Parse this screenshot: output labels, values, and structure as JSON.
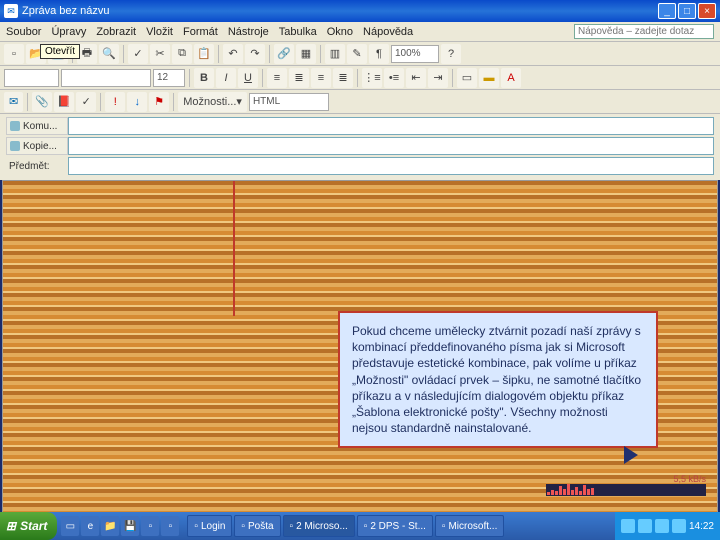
{
  "window": {
    "title": "Zpráva bez názvu",
    "icon_glyph": "✉"
  },
  "menu": [
    "Soubor",
    "Úpravy",
    "Zobrazit",
    "Vložit",
    "Formát",
    "Nástroje",
    "Tabulka",
    "Okno",
    "Nápověda"
  ],
  "help_placeholder": "Nápověda – zadejte dotaz",
  "tooltip": "Otevřít",
  "toolbar1": {
    "zoom": "100%"
  },
  "toolbar2": {
    "font_size": "12",
    "style_placeholder": ""
  },
  "toolbar3": {
    "label_moznosti": "Možnosti...",
    "format": "HTML"
  },
  "fields": {
    "to": "Komu...",
    "cc": "Kopie...",
    "subject": "Předmět:"
  },
  "callout": "Pokud chceme umělecky ztvárnit pozadí naší zprávy s kombinací předdefinovaného písma jak si Microsoft představuje estetické kombinace, pak volíme u příkaz „Možnosti\" ovládací prvek – šipku, ne samotné tlačítko příkazu a v následujícím dialogovém objektu příkaz „Šablona elektronické pošty\". Všechny možnosti nejsou standardně nainstalované.",
  "tray": {
    "rate": "5,5 kB/s"
  },
  "taskbar": {
    "start": "Start",
    "tasks": [
      "Login",
      "Pošta",
      "2 Microso...",
      "2 DPS - St...",
      "Microsoft..."
    ],
    "clock": "14:22"
  }
}
